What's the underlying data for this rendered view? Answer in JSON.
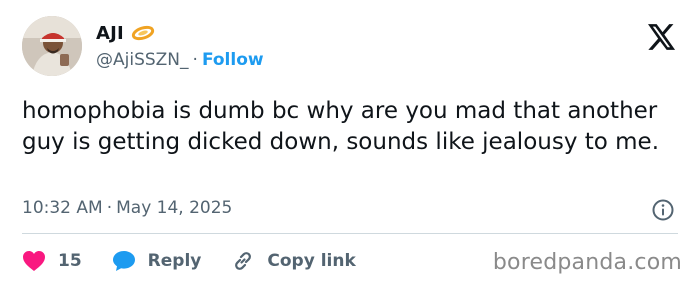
{
  "author": {
    "display_name": "AJI",
    "handle": "@AjiSSZN_",
    "separator": "·",
    "follow_label": "Follow",
    "badge_icon": "orange-ring-icon"
  },
  "tweet": {
    "text": "homophobia is dumb bc why are you mad that another guy is getting dicked down, sounds like jealousy to me.",
    "time": "10:32 AM",
    "date": "May 14, 2025"
  },
  "actions": {
    "like_count": "15",
    "reply_label": "Reply",
    "copy_label": "Copy link"
  },
  "watermark": "boredpanda.com",
  "colors": {
    "accent": "#1d9bf0",
    "like": "#f91880",
    "text": "#0f1419",
    "muted": "#536471"
  }
}
